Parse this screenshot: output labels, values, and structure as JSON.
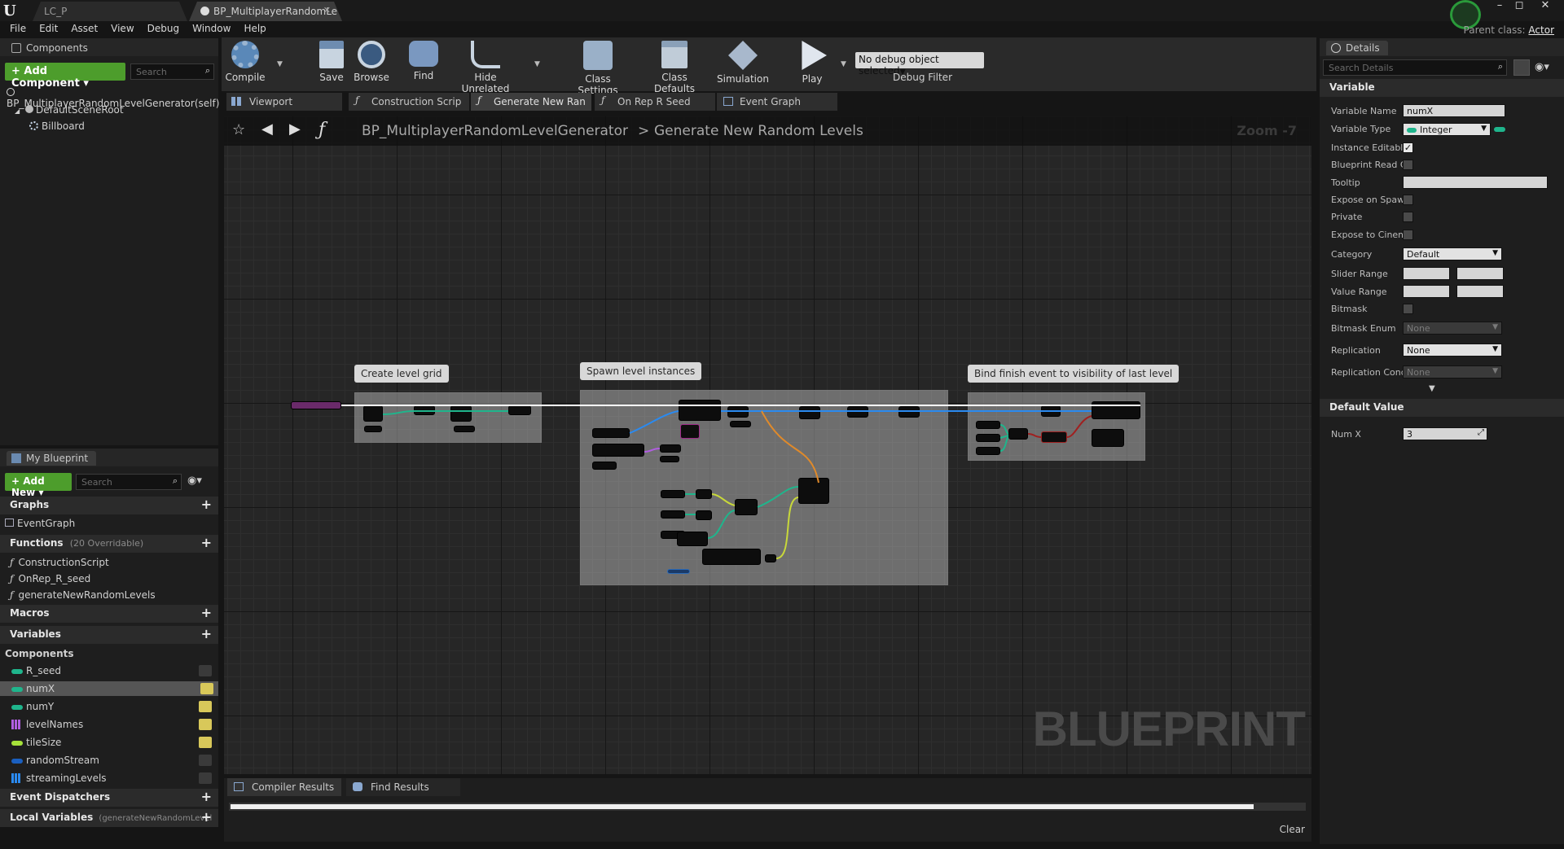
{
  "title_bar": {
    "tabs": [
      {
        "label": "LC_P"
      },
      {
        "label": "BP_MultiplayerRandomLe"
      }
    ],
    "parent_class_label": "Parent class:",
    "parent_class_value": "Actor",
    "window_buttons": [
      "–",
      "◻",
      "✕"
    ]
  },
  "menu": [
    "File",
    "Edit",
    "Asset",
    "View",
    "Debug",
    "Window",
    "Help"
  ],
  "components_panel": {
    "tab": "Components",
    "add_button": "+ Add Component ▾",
    "search_placeholder": "Search",
    "self_item": "BP_MultiplayerRandomLevelGenerator(self)",
    "tree": [
      "DefaultSceneRoot",
      "Billboard"
    ]
  },
  "toolbar": {
    "buttons": [
      {
        "label": "Compile"
      },
      {
        "label": "Save"
      },
      {
        "label": "Browse"
      },
      {
        "label": "Find"
      },
      {
        "label": "Hide Unrelated"
      },
      {
        "label": "Class Settings"
      },
      {
        "label": "Class Defaults"
      },
      {
        "label": "Simulation"
      },
      {
        "label": "Play"
      }
    ],
    "debug_select": "No debug object selected",
    "debug_filter": "Debug Filter"
  },
  "graph_tabs": [
    {
      "label": "Viewport"
    },
    {
      "label": "Construction Scrip"
    },
    {
      "label": "Generate New Ran"
    },
    {
      "label": "On Rep R Seed"
    },
    {
      "label": "Event Graph"
    }
  ],
  "graph": {
    "breadcrumb_class": "BP_MultiplayerRandomLevelGenerator",
    "breadcrumb_separator": ">",
    "breadcrumb_function": "Generate New Random Levels",
    "zoom": "Zoom -7",
    "watermark": "BLUEPRINT",
    "comments": [
      {
        "label": "Create level grid"
      },
      {
        "label": "Spawn level instances"
      },
      {
        "label": "Bind finish event to visibility of last level"
      }
    ]
  },
  "my_blueprint": {
    "tab": "My Blueprint",
    "add_button": "+ Add New ▾",
    "search_placeholder": "Search",
    "graphs_header": "Graphs",
    "graphs": [
      "EventGraph"
    ],
    "functions_header": "Functions",
    "functions_note": "(20 Overridable)",
    "functions": [
      "ConstructionScript",
      "OnRep_R_seed",
      "generateNewRandomLevels"
    ],
    "macros_header": "Macros",
    "variables_header": "Variables",
    "components_sub": "Components",
    "variables": [
      {
        "name": "R_seed",
        "color": "#1fb58c"
      },
      {
        "name": "numX",
        "color": "#1fb58c"
      },
      {
        "name": "numY",
        "color": "#1fb58c"
      },
      {
        "name": "levelNames",
        "color": "#b05ee0"
      },
      {
        "name": "tileSize",
        "color": "#a6e23a"
      },
      {
        "name": "randomStream",
        "color": "#1a5fbf"
      },
      {
        "name": "streamingLevels",
        "color": "#2a8af0"
      }
    ],
    "dispatchers_header": "Event Dispatchers",
    "local_vars_header": "Local Variables",
    "local_vars_note": "(generateNewRandomLevel"
  },
  "bottom": {
    "tabs": [
      {
        "label": "Compiler Results"
      },
      {
        "label": "Find Results"
      }
    ],
    "clear": "Clear"
  },
  "details": {
    "tab": "Details",
    "search_placeholder": "Search Details",
    "variable_header": "Variable",
    "props": {
      "variable_name_label": "Variable Name",
      "variable_name_value": "numX",
      "variable_type_label": "Variable Type",
      "variable_type_value": "Integer",
      "instance_editable_label": "Instance Editabl",
      "blueprint_read_label": "Blueprint Read C",
      "tooltip_label": "Tooltip",
      "expose_spawn_label": "Expose on Spaw",
      "private_label": "Private",
      "expose_cinematics_label": "Expose to Cinem",
      "category_label": "Category",
      "category_value": "Default",
      "slider_range_label": "Slider Range",
      "value_range_label": "Value Range",
      "bitmask_label": "Bitmask",
      "bitmask_enum_label": "Bitmask Enum",
      "bitmask_enum_value": "None",
      "replication_label": "Replication",
      "replication_value": "None",
      "replication_cond_label": "Replication Conc",
      "replication_cond_value": "None"
    },
    "default_value_header": "Default Value",
    "num_x_label": "Num X",
    "num_x_value": "3"
  },
  "colors": {
    "accent_green": "#4d9d2c",
    "integer_pin": "#1fb58c",
    "exec_wire": "#ffffff",
    "wire_blue": "#2a8af0",
    "wire_orange": "#e08a2a",
    "wire_yellow": "#c8d83a"
  }
}
